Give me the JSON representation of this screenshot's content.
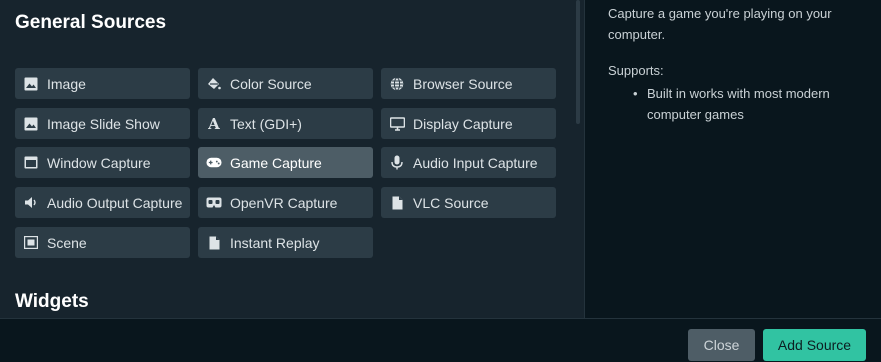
{
  "sections": {
    "general_title": "General Sources",
    "widgets_title": "Widgets"
  },
  "sources": [
    {
      "label": "Image",
      "icon": "image-icon"
    },
    {
      "label": "Color Source",
      "icon": "paint-bucket-icon"
    },
    {
      "label": "Browser Source",
      "icon": "globe-icon"
    },
    {
      "label": "Image Slide Show",
      "icon": "image-icon"
    },
    {
      "label": "Text (GDI+)",
      "icon": "text-icon"
    },
    {
      "label": "Display Capture",
      "icon": "monitor-icon"
    },
    {
      "label": "Window Capture",
      "icon": "window-icon"
    },
    {
      "label": "Game Capture",
      "icon": "gamepad-icon",
      "selected": true
    },
    {
      "label": "Audio Input Capture",
      "icon": "microphone-icon"
    },
    {
      "label": "Audio Output Capture",
      "icon": "speaker-icon"
    },
    {
      "label": "OpenVR Capture",
      "icon": "vr-headset-icon"
    },
    {
      "label": "VLC Source",
      "icon": "file-icon"
    },
    {
      "label": "Scene",
      "icon": "scene-icon"
    },
    {
      "label": "Instant Replay",
      "icon": "file-icon"
    }
  ],
  "description": {
    "text": "Capture a game you're playing on your computer.",
    "supports_label": "Supports:",
    "supports_items": [
      "Built in works with most modern computer games"
    ]
  },
  "footer": {
    "close_label": "Close",
    "add_label": "Add Source"
  },
  "colors": {
    "accent": "#31c3a2",
    "panel": "#17242d",
    "tile": "#2c3c46",
    "tile_selected": "#4d5d66"
  }
}
